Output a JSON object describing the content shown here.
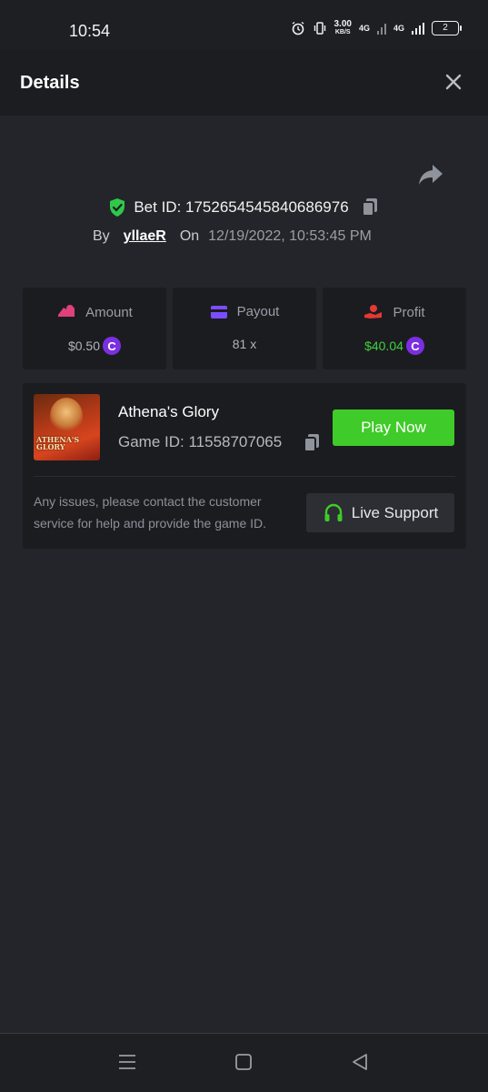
{
  "status_bar": {
    "time": "10:54",
    "speed_value": "3.00",
    "speed_unit": "KB/S",
    "net1": "4G",
    "net2": "4G",
    "battery": "2"
  },
  "header": {
    "title": "Details"
  },
  "bet": {
    "label": "Bet ID: 1752654545840686976",
    "by_label": "By",
    "user": "yllaeR",
    "on_label": "On",
    "date": "12/19/2022, 10:53:45 PM"
  },
  "stats": [
    {
      "label": "Amount",
      "value": "$0.50",
      "icon": "amount-icon",
      "coin": true
    },
    {
      "label": "Payout",
      "value": "81 x",
      "icon": "payout-card-icon",
      "coin": false
    },
    {
      "label": "Profit",
      "value": "$40.04",
      "icon": "profit-icon",
      "coin": true
    }
  ],
  "coin_symbol": "C",
  "game": {
    "title": "Athena's Glory",
    "game_id": "Game ID: 11558707065",
    "thumb_text": "ATHENA'S GLORY",
    "play_label": "Play Now",
    "issue_text": "Any issues, please contact the customer service for help and provide the game ID.",
    "support_label": "Live Support"
  },
  "colors": {
    "background": "#24252a",
    "card": "#1b1c20",
    "play_button": "#3fcb29",
    "profit_green": "#3fd13c",
    "coin_purple": "#7b2fe0",
    "amount_pink": "#e0417a",
    "payout_purple": "#7c4dff",
    "profit_red": "#e53935"
  }
}
